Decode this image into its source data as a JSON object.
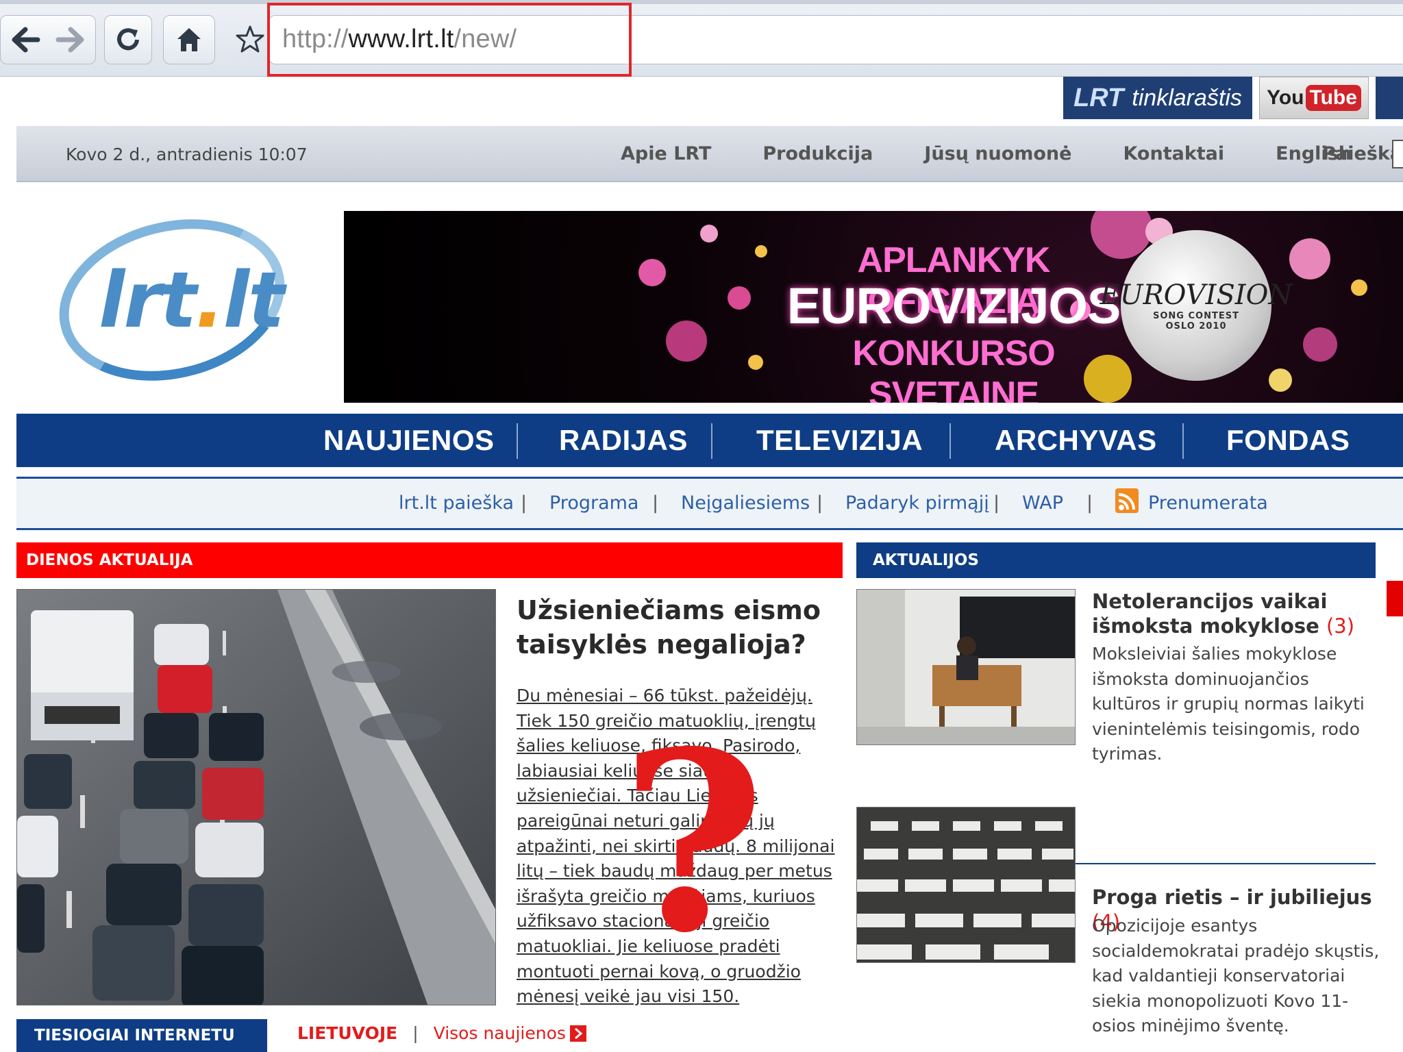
{
  "browser": {
    "url_prefix": "http://",
    "url_domain": "www.lrt.lt",
    "url_path": "/new/"
  },
  "header_buttons": {
    "blog_brand": "LRT",
    "blog_label": "tinklaraštis",
    "youtube_you": "You",
    "youtube_tube": "Tube"
  },
  "infobar": {
    "datetime": "Kovo 2 d., antradienis 10:07",
    "links": [
      "Apie LRT",
      "Produkcija",
      "Jūsų nuomonė",
      "Kontaktai",
      "English"
    ],
    "search_label": "Paieška:"
  },
  "logo": {
    "text_a": "lrt",
    "text_dot": ".",
    "text_b": "lt"
  },
  "banner": {
    "line1": "APLANKYK OFICIALIĄ",
    "line2": "EUROVIZIJOS",
    "line3": "KONKURSO SVETAINĘ",
    "disc_title": "EUROVISION",
    "disc_sub": "SONG CONTEST",
    "disc_sub2": "OSLO 2010"
  },
  "main_nav": [
    "NAUJIENOS",
    "RADIJAS",
    "TELEVIZIJA",
    "ARCHYVAS",
    "FONDAS"
  ],
  "sub_nav": [
    "lrt.lt paieška",
    "Programa",
    "Neįgaliesiems",
    "Padaryk pirmąjį",
    "WAP",
    "Prenumerata"
  ],
  "sub_nav_separator": "|",
  "sections": {
    "daily": "DIENOS AKTUALIJA",
    "news": "AKTUALIJOS",
    "live": "TIESIOGIAI INTERNETU"
  },
  "main_story": {
    "headline": "Užsieniečiams eismo taisyklės negalioja?",
    "body": "Du mėnesiai – 66 tūkst. pažeidėjų. Tiek 150 greičio matuoklių, įrengtų šalies keliuose, fiksavo. Pasirodo, labiausiai keliuose siautėja užsieniečiai. Tačiau Lietuvos pareigūnai neturi galimybių jų atpažinti, nei skirti baudų. 8 milijonai litų – tiek baudų maždaug per metus išrašyta greičio mėgėjams, kuriuos užfiksavo stacionarieji greičio matuokliai. Jie keliuose pradėti montuoti pernai kovą, o gruodžio mėnesį veikė jau visi 150.",
    "overlay_mark": "?"
  },
  "side_stories": [
    {
      "title": "Netolerancijos vaikai išmoksta mokyklose",
      "comments": "(3)",
      "text": "Moksleiviai šalies mokyklose išmoksta dominuojančios kultūros ir grupių normas laikyti vienintelėmis teisingomis, rodo tyrimas."
    },
    {
      "title": "Proga rietis – ir jubiliejus",
      "comments": "(4)",
      "text": "Opozicijoje esantys socialdemokratai pradėjo skųstis, kad valdantieji konservatoriai siekia monopolizuoti Kovo 11-osios minėjimo šventę."
    }
  ],
  "bottom_tabs": {
    "local": "LIETUVOJE",
    "separator": "|",
    "all": "Visos naujienos"
  },
  "colors": {
    "nav_blue": "#0e3d86",
    "alert_red": "#ff0000",
    "link_blue": "#2d5fa6",
    "highlight_red": "#e0262a"
  },
  "icons": [
    "back-arrow-icon",
    "forward-arrow-icon",
    "reload-icon",
    "home-icon",
    "star-bookmark-icon",
    "rss-icon",
    "arrow-right-icon",
    "twitter-icon"
  ]
}
